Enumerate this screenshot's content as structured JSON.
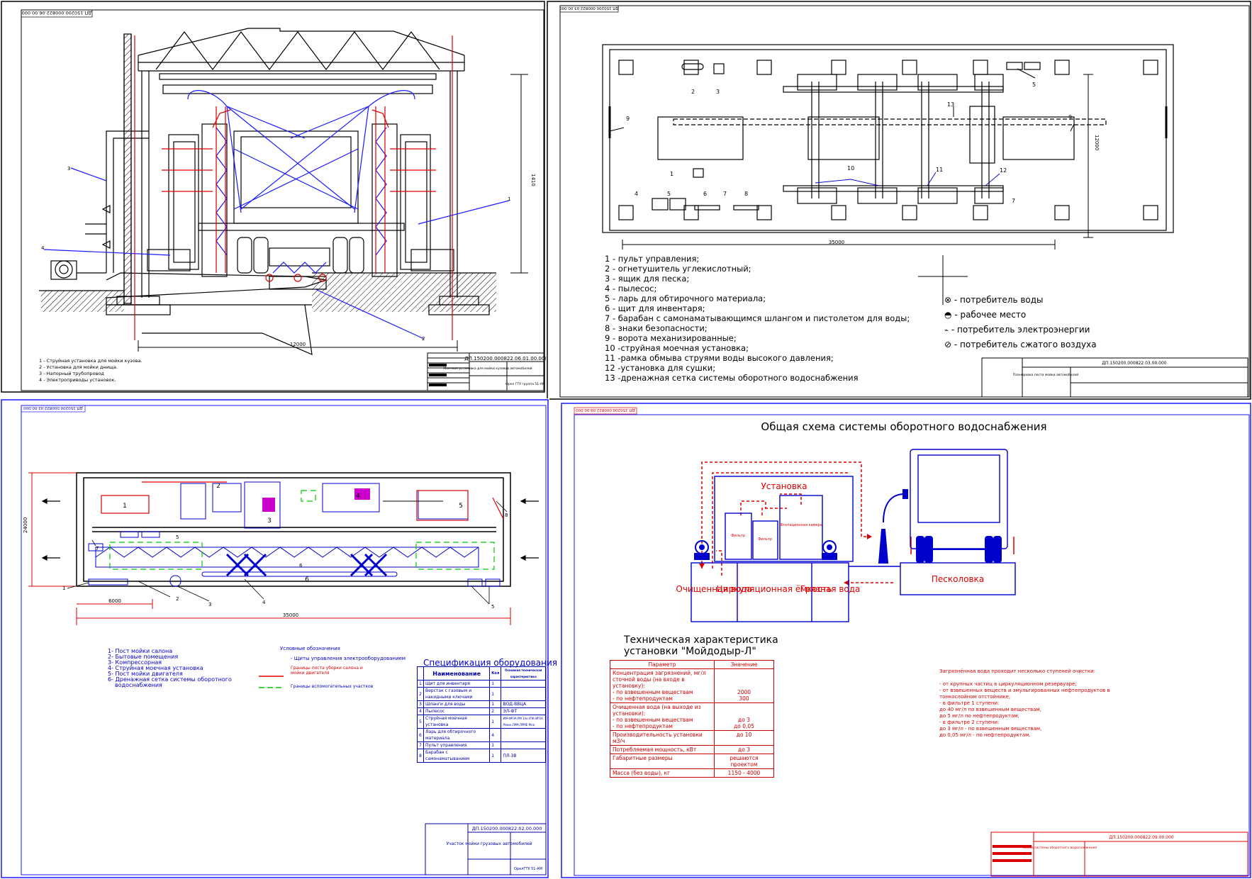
{
  "sheet_tl": {
    "doc_code_rot": "ДП.150200.000822.06.00.000",
    "dimension_width": "12000",
    "dimension_height": "1410",
    "callouts": [
      "3",
      "4",
      "1",
      "2"
    ],
    "legend": [
      "1 - Струйная установка для мойки кузова.",
      "2 - Установка для мойки днища.",
      "3 - Напорный трубопровод",
      "4 - Электроприводы установок."
    ],
    "stamp_code": "ДП.150200.000822.06.01.00.000",
    "stamp_title": "Моечная установка для мойки кузовов автомобилей",
    "stamp_org": "Орел ГТУ группа 51-АМ"
  },
  "sheet_tr": {
    "doc_code_rot": "ДП.150200.000822.03.00.000",
    "dimension_length": "35000",
    "dimension_width": "12000",
    "callouts": [
      "2",
      "3",
      "5",
      "9",
      "13",
      "9",
      "10",
      "11",
      "12",
      "1",
      "4",
      "5",
      "6",
      "7",
      "8",
      "7"
    ],
    "legend": [
      "1 - пульт управления;",
      "2 - огнетушитель углекислотный;",
      "3 - ящик для песка;",
      "4 - пылесос;",
      "5 - ларь для обтирочного материала;",
      "6 - щит для инвентаря;",
      "7 - барабан с самонаматывающимся шлангом и пистолетом для воды;",
      "8 - знаки безопасности;",
      "9 - ворота механизированные;",
      "10 -струйная моечная установка;",
      "11 -рамка обмыва струями воды высокого давления;",
      "12 -установка для сушки;",
      "13 -дренажная сетка системы оборотного водоснабжения"
    ],
    "symbols": [
      {
        "icon": "water-consumer-icon",
        "label": "- потребитель воды"
      },
      {
        "icon": "workplace-icon",
        "label": "- рабочее место"
      },
      {
        "icon": "electric-consumer-icon",
        "label": "- потребитель электроэнергии"
      },
      {
        "icon": "air-consumer-icon",
        "label": "- потребитель сжатого воздуха"
      }
    ],
    "stamp_code": "ДП.150200.000822.03.00.000",
    "stamp_title": "Планировка поста мойки автомобилей"
  },
  "sheet_bl": {
    "doc_code_rot": "ДП.150200.000822.02.00.000",
    "dimension_length": "35000",
    "dimension_height": "24000",
    "dimension_small": "6000",
    "zone_numbers": [
      "1",
      "2",
      "3",
      "4",
      "5",
      "6"
    ],
    "callouts": [
      "7",
      "5",
      "6",
      "8",
      "1",
      "2",
      "3",
      "4",
      "5"
    ],
    "legend": [
      "1- Пост мойки салона",
      "2- Бытовые помещения",
      "3- Компрессорная",
      "4- Струйная моечная установка",
      "5- Пост мойки двигателя",
      "6- Дренажная сетка системы оборотного",
      "водоснабжения"
    ],
    "conventions_title": "Условные обозначения",
    "conventions": [
      "- Щиты управления электрооборудованием",
      "Границы поста уборки салона и мойки двигателя",
      "Границы вспомогательных участков"
    ],
    "spec_title": "Спецификация оборудования",
    "spec_headers": [
      "Наименование",
      "Кол",
      "Основная техническая характеристика"
    ],
    "spec_rows": [
      [
        "Щит для инвентаря",
        "1",
        ""
      ],
      [
        "Верстак с газовым и накидными ключами",
        "1",
        ""
      ],
      [
        "Шланги для воды",
        "1",
        "ВОД-ВВЦА"
      ],
      [
        "Пылесос",
        "2",
        "ЭЛ-ФТ"
      ],
      [
        "Струйная моечная установка",
        "1",
        "ИМ-ФРЗА-РМ 1/м 4ПК-ИРЗА Р/мин,ЛРМ,ЛРМЕ Мпа"
      ],
      [
        "Ларь для обтирочного материала",
        "4",
        ""
      ],
      [
        "Пульт управления",
        "1",
        ""
      ],
      [
        "Барабан с самонаматыванием",
        "1",
        "ПЛ-ЗВ"
      ]
    ],
    "stamp_code": "ДП.150200.000822.02.00.000",
    "stamp_title": "Участок мойки грузовых автомобилей",
    "stamp_org": "ОрелГТУ 51-АМ"
  },
  "sheet_br": {
    "doc_code_rot": "ДП.150200.000822.09.00.000",
    "title": "Общая схема системы оборотного водоснабжения",
    "labels": {
      "installation": "Установка",
      "filter": "Фильтр",
      "filter2": "Фильтр",
      "flotation": "Флотационная камера",
      "clean_water": "Очищенная вода",
      "circulation": "Циркуляционная ёмкость",
      "dirty_water": "Грязная вода",
      "sand_trap": "Песколовка"
    },
    "tech_title_1": "Техническая характеристика",
    "tech_title_2": "установки \"Мойдодыр-Л\"",
    "tech_headers": [
      "Параметр",
      "Значение"
    ],
    "tech_rows": [
      [
        "Концентрация загрязнений, мг/л сточной воды (на входе в установку):",
        ""
      ],
      [
        "- по взвешенным веществам",
        "2000"
      ],
      [
        "- по нефтепродуктам",
        "300"
      ],
      [
        "Очищенная вода (на выходе из установки):",
        ""
      ],
      [
        "- по взвешенным веществам",
        "до 3"
      ],
      [
        "- по нефтепродуктам",
        "до 0,05"
      ],
      [
        "Производительность установки м3/ч",
        "до 10"
      ],
      [
        "Потребляемая мощность, кВт",
        "до 3"
      ],
      [
        "Габаритные размеры",
        "решаются проектом"
      ],
      [
        "Масса (без воды), кг",
        "1150 - 4000"
      ]
    ],
    "notes": [
      "Загрязнённая вода проходит несколько ступеней очистки:",
      "",
      "- от крупных частиц в циркуляционном резервуаре;",
      "- от взвешенных веществ и эмульгированных нефтепродуктов в",
      "тонкослойном отстойнике;",
      "- в фильтре 1 ступени:",
      "до 40 мг/л по взвешенным веществам,",
      "до 5 мг/л по нефтепродуктам;",
      "- в фильтре 2 ступени:",
      "до 3 мг/л - по взвешенным веществам,",
      "до 0,05 мг/л - по нефтепродуктам."
    ],
    "stamp_code": "ДП.150200.000822.09.00.000",
    "stamp_title": "Схема системы оборотного водоснабжения"
  }
}
